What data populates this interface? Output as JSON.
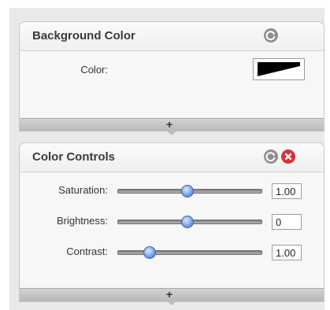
{
  "panels": [
    {
      "title": "Background Color",
      "color_label": "Color:",
      "reset_icon": "reset-icon",
      "add_icon": "plus-icon",
      "add_label": "+"
    },
    {
      "title": "Color Controls",
      "reset_icon": "reset-icon",
      "close_icon": "close-icon",
      "add_label": "+",
      "controls": [
        {
          "label": "Saturation:",
          "value": "1.00",
          "level": 0.5
        },
        {
          "label": "Brightness:",
          "value": "0",
          "level": 0.5
        },
        {
          "label": "Contrast:",
          "value": "1.00",
          "level": 0.25
        }
      ]
    }
  ],
  "colors": {
    "close_button": "#d7333b",
    "slider_knob": "#6f9ee6"
  }
}
